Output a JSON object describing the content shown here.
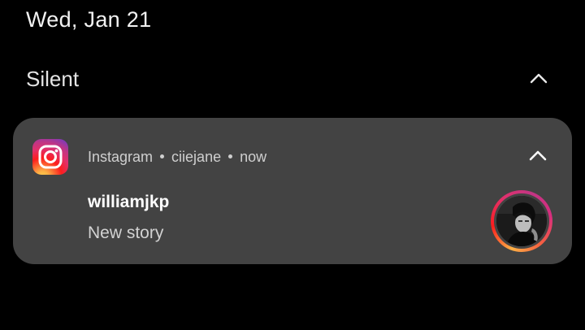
{
  "lock_screen": {
    "date": "Wed, Jan 21"
  },
  "section": {
    "title": "Silent",
    "chevron_icon": "chevron-up-icon"
  },
  "notification": {
    "app_name": "Instagram",
    "account": "ciiejane",
    "time": "now",
    "sender": "williamjkp",
    "message": "New story",
    "app_icon": "instagram-icon",
    "chevron_icon": "chevron-up-icon",
    "avatar": "story-avatar"
  },
  "colors": {
    "background": "#000000",
    "card": "#434343",
    "instagram_gradient": [
      "#ffd34e",
      "#fd1d1d",
      "#c13584",
      "#833ab4"
    ]
  }
}
